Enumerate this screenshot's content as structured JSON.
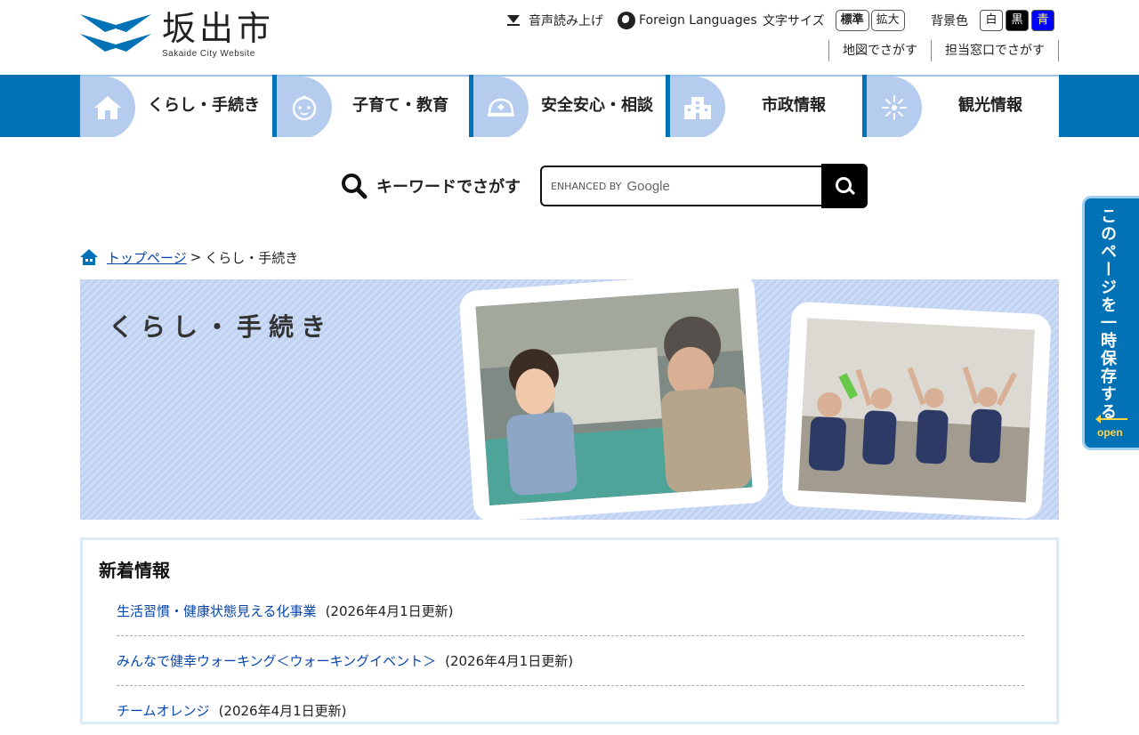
{
  "header": {
    "logo_title": "坂出市",
    "logo_sub": "Sakaide City Website",
    "voice_read": "音声読み上げ",
    "foreign_languages": "Foreign Languages",
    "font_size_label": "文字サイズ",
    "font_size_standard": "標準",
    "font_size_large": "拡大",
    "bg_color_label": "背景色",
    "bg_white": "白",
    "bg_black": "黒",
    "bg_blue": "青",
    "map_search": "地図でさがす",
    "office_search": "担当窓口でさがす"
  },
  "nav": {
    "items": [
      {
        "label": "くらし・手続き",
        "icon": "house-icon"
      },
      {
        "label": "子育て・教育",
        "icon": "baby-icon"
      },
      {
        "label": "安全安心・相談",
        "icon": "helmet-icon"
      },
      {
        "label": "市政情報",
        "icon": "building-icon"
      },
      {
        "label": "観光情報",
        "icon": "firework-icon"
      }
    ]
  },
  "search": {
    "label": "キーワードでさがす",
    "enhanced_by": "ENHANCED BY",
    "google": "Google"
  },
  "breadcrumb": {
    "home": "トップページ",
    "separator": ">",
    "current": "くらし・手続き"
  },
  "hero": {
    "title": "くらし・手続き"
  },
  "news": {
    "heading": "新着情報",
    "items": [
      {
        "title": "生活習慣・健康状態見える化事業",
        "date": "(2026年4月1日更新)"
      },
      {
        "title": "みんなで健幸ウォーキング＜ウォーキングイベント＞",
        "date": "(2026年4月1日更新)"
      },
      {
        "title": "チームオレンジ",
        "date": "(2026年4月1日更新)"
      }
    ]
  },
  "save_tab": {
    "label": "このページを一時保存する",
    "open": "open"
  },
  "colors": {
    "nav_blue": "#0072b5",
    "icon_bg": "#b5ccee",
    "link": "#0645ad"
  }
}
